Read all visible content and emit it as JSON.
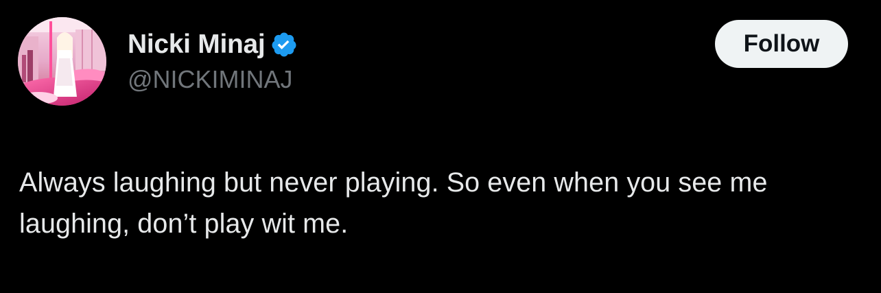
{
  "author": {
    "display_name": "Nicki Minaj",
    "handle": "@NICKIMINAJ",
    "verified": true,
    "verified_color": "#1d9bf0",
    "avatar_icon": "profile-avatar"
  },
  "actions": {
    "follow_label": "Follow"
  },
  "tweet": {
    "text": "Always laughing but never playing. So even when you see me laughing, don’t play wit me."
  },
  "colors": {
    "background": "#000000",
    "primary_text": "#e7e9ea",
    "secondary_text": "#71767b",
    "follow_bg": "#eff3f4",
    "follow_text": "#0f1419"
  }
}
